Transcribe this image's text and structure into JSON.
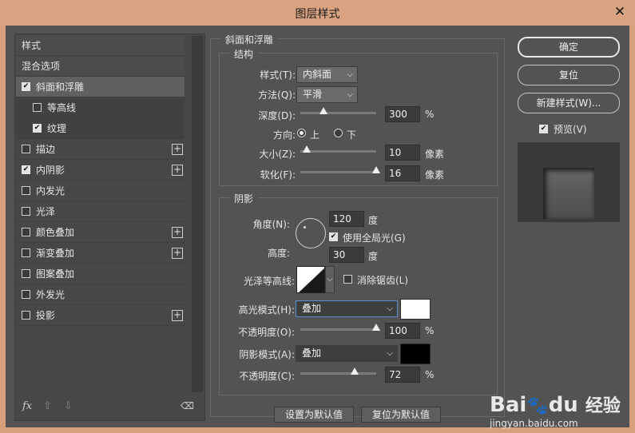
{
  "window": {
    "title": "图层样式"
  },
  "styles_list": {
    "header": "样式",
    "blend": "混合选项",
    "items": [
      {
        "label": "斜面和浮雕",
        "checked": true,
        "selected": true,
        "sub": false,
        "plus": false
      },
      {
        "label": "等高线",
        "checked": false,
        "selected": false,
        "sub": true,
        "plus": false
      },
      {
        "label": "纹理",
        "checked": true,
        "selected": false,
        "sub": true,
        "plus": false
      },
      {
        "label": "描边",
        "checked": false,
        "selected": false,
        "sub": false,
        "plus": true
      },
      {
        "label": "内阴影",
        "checked": true,
        "selected": false,
        "sub": false,
        "plus": true
      },
      {
        "label": "内发光",
        "checked": false,
        "selected": false,
        "sub": false,
        "plus": false
      },
      {
        "label": "光泽",
        "checked": false,
        "selected": false,
        "sub": false,
        "plus": false
      },
      {
        "label": "颜色叠加",
        "checked": false,
        "selected": false,
        "sub": false,
        "plus": true
      },
      {
        "label": "渐变叠加",
        "checked": false,
        "selected": false,
        "sub": false,
        "plus": true
      },
      {
        "label": "图案叠加",
        "checked": false,
        "selected": false,
        "sub": false,
        "plus": false
      },
      {
        "label": "外发光",
        "checked": false,
        "selected": false,
        "sub": false,
        "plus": false
      },
      {
        "label": "投影",
        "checked": false,
        "selected": false,
        "sub": false,
        "plus": true
      }
    ],
    "footer": {
      "fx": "fx",
      "up": "⇧",
      "down": "⇩",
      "trash": "🗑"
    }
  },
  "buttons": {
    "ok": "确定",
    "reset": "复位",
    "new_style": "新建样式(W)...",
    "preview_label": "预览(V)",
    "preview_checked": true
  },
  "bevel": {
    "title": "斜面和浮雕",
    "structure": {
      "title": "结构",
      "style_label": "样式(T):",
      "style_value": "内斜面",
      "technique_label": "方法(Q):",
      "technique_value": "平滑",
      "depth_label": "深度(D):",
      "depth_value": "300",
      "depth_unit": "%",
      "depth_pct": 0.3,
      "direction_label": "方向:",
      "dir_up": "上",
      "dir_down": "下",
      "dir_selected": "上",
      "size_label": "大小(Z):",
      "size_value": "10",
      "size_unit": "像素",
      "size_pct": 0.08,
      "soften_label": "软化(F):",
      "soften_value": "16",
      "soften_unit": "像素",
      "soften_pct": 1.0
    },
    "shading": {
      "title": "阴影",
      "angle_label": "角度(N):",
      "angle_value": "120",
      "angle_unit": "度",
      "global_light_label": "使用全局光(G)",
      "global_light_checked": true,
      "altitude_label": "高度:",
      "altitude_value": "30",
      "altitude_unit": "度",
      "gloss_label": "光泽等高线:",
      "antialias_label": "消除锯齿(L)",
      "antialias_checked": false,
      "highlight_mode_label": "高光模式(H):",
      "highlight_mode_value": "叠加",
      "highlight_color": "#ffffff",
      "highlight_opacity_label": "不透明度(O):",
      "highlight_opacity_value": "100",
      "highlight_opacity_unit": "%",
      "highlight_opacity_pct": 1.0,
      "shadow_mode_label": "阴影模式(A):",
      "shadow_mode_value": "叠加",
      "shadow_color": "#000000",
      "shadow_opacity_label": "不透明度(C):",
      "shadow_opacity_value": "72",
      "shadow_opacity_unit": "%",
      "shadow_opacity_pct": 0.72
    },
    "make_default": "设置为默认值",
    "reset_default": "复位为默认值"
  },
  "watermark": {
    "brand": "Bai",
    "brand2": "du",
    "product": "经验",
    "url": "jingyan.baidu.com"
  }
}
